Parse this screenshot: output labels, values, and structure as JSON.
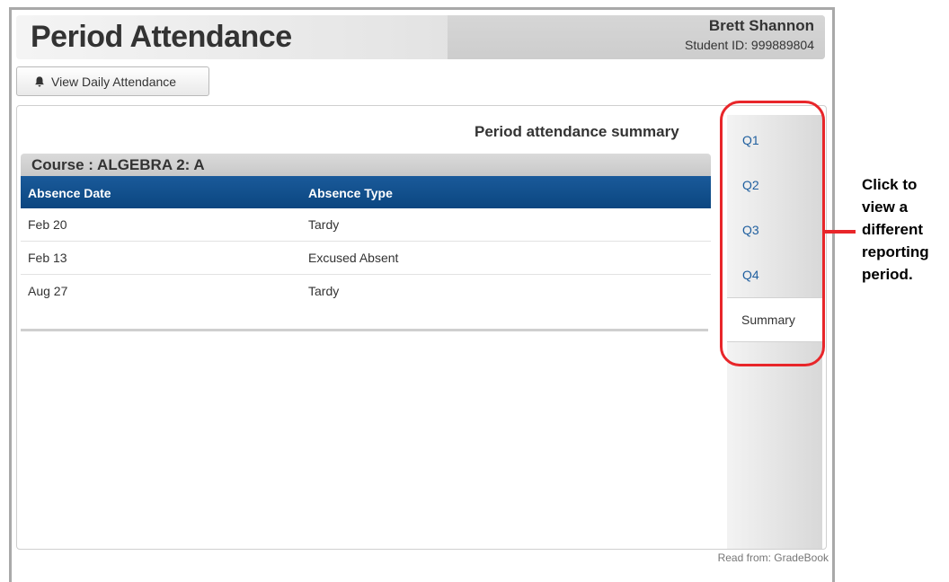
{
  "header": {
    "title": "Period Attendance",
    "student_name": "Brett Shannon",
    "student_id_label": "Student ID: 999889804"
  },
  "toolbar": {
    "view_daily_label": "View Daily Attendance",
    "view_daily_icon": "bell-icon"
  },
  "summary": {
    "title": "Period attendance summary",
    "course_label": "Course : ALGEBRA 2: A",
    "columns": [
      "Absence Date",
      "Absence Type"
    ],
    "rows": [
      {
        "date": "Feb 20",
        "type": "Tardy"
      },
      {
        "date": "Feb 13",
        "type": "Excused Absent"
      },
      {
        "date": "Aug 27",
        "type": "Tardy"
      }
    ]
  },
  "tabs": [
    {
      "label": "Q1",
      "active": false
    },
    {
      "label": "Q2",
      "active": false
    },
    {
      "label": "Q3",
      "active": false
    },
    {
      "label": "Q4",
      "active": false
    },
    {
      "label": "Summary",
      "active": true
    }
  ],
  "callout": {
    "lines": [
      "Click to",
      "view a",
      "different",
      "reporting",
      "period."
    ],
    "color": "#e8262a"
  },
  "footer": {
    "read_from": "Read from: GradeBook"
  }
}
